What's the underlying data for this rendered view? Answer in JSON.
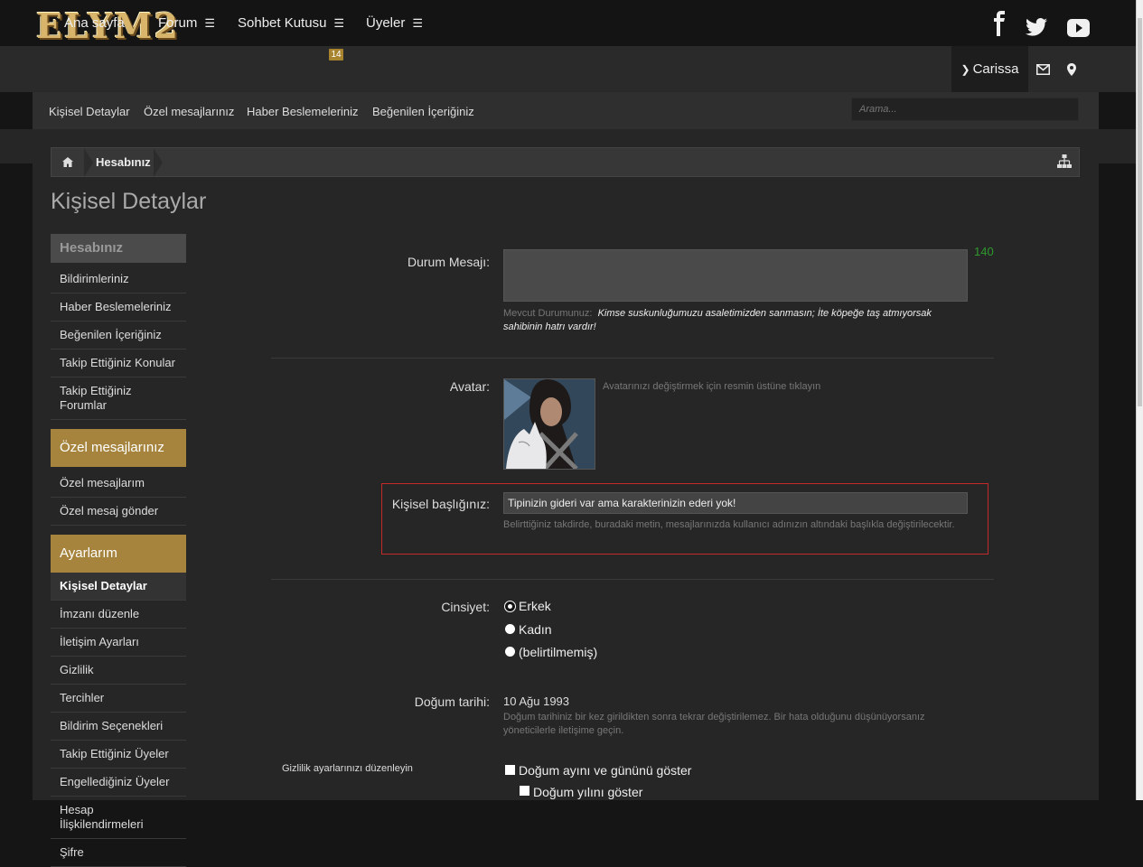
{
  "header": {
    "logo_text": "ELYM2",
    "social": [
      "facebook-icon",
      "twitter-icon",
      "youtube-icon"
    ]
  },
  "nav": {
    "items": [
      {
        "label": "Ana sayfa"
      },
      {
        "label": "Forum"
      },
      {
        "label": "Sohbet Kutusu",
        "badge": "14"
      },
      {
        "label": "Üyeler"
      }
    ],
    "user": "Carissa"
  },
  "subnav": {
    "items": [
      "Kişisel Detaylar",
      "Özel mesajlarınız",
      "Haber Beslemeleriniz",
      "Beğenilen İçeriğiniz"
    ],
    "search_placeholder": "Arama..."
  },
  "breadcrumb": {
    "current": "Hesabınız"
  },
  "page_title": "Kişisel Detaylar",
  "sidebar": {
    "account_head": "Hesabınız",
    "account_links": [
      "Bildirimleriniz",
      "Haber Beslemeleriniz",
      "Beğenilen İçeriğiniz",
      "Takip Ettiğiniz Konular",
      "Takip Ettiğiniz Forumlar"
    ],
    "pm_head": "Özel mesajlarınız",
    "pm_links": [
      "Özel mesajlarım",
      "Özel mesaj gönder"
    ],
    "settings_head": "Ayarlarım",
    "settings_links": [
      "Kişisel Detaylar",
      "İmzanı düzenle",
      "İletişim Ayarları",
      "Gizlilik",
      "Tercihler",
      "Bildirim Seçenekleri",
      "Takip Ettiğiniz Üyeler",
      "Engellediğiniz Üyeler",
      "Hesap İlişkilendirmeleri",
      "Şifre"
    ]
  },
  "form": {
    "status_label": "Durum Mesajı:",
    "status_counter": "140",
    "current_status_label": "Mevcut Durumunuz:",
    "current_status": "Kimse suskunluğumuzu asaletimizden sanmasın; İte köpeğe taş atmıyorsak sahibinin hatrı vardır!",
    "avatar_label": "Avatar:",
    "avatar_hint": "Avatarınızı değiştirmek için resmin üstüne tıklayın",
    "title_label": "Kişisel başlığınız:",
    "title_value": "Tipinizin gideri var ama karakterinizin ederi yok!",
    "title_hint": "Belirttiğiniz takdirde, buradaki metin, mesajlarınızda kullanıcı adınızın altındaki başlıkla değiştirilecektir.",
    "gender_label": "Cinsiyet:",
    "gender_options": [
      "Erkek",
      "Kadın",
      "(belirtilmemiş)"
    ],
    "dob_label": "Doğum tarihi:",
    "dob_value": "10 Ağu 1993",
    "dob_hint": "Doğum tarihiniz bir kez girildikten sonra tekrar değiştirilemez. Bir hata olduğunu düşünüyorsanız yöneticilerle iletişime geçin.",
    "privacy_label": "Gizlilik ayarlarınızı düzenleyin",
    "privacy_options": [
      "Doğum ayını ve gününü göster",
      "Doğum yılını göster"
    ]
  }
}
